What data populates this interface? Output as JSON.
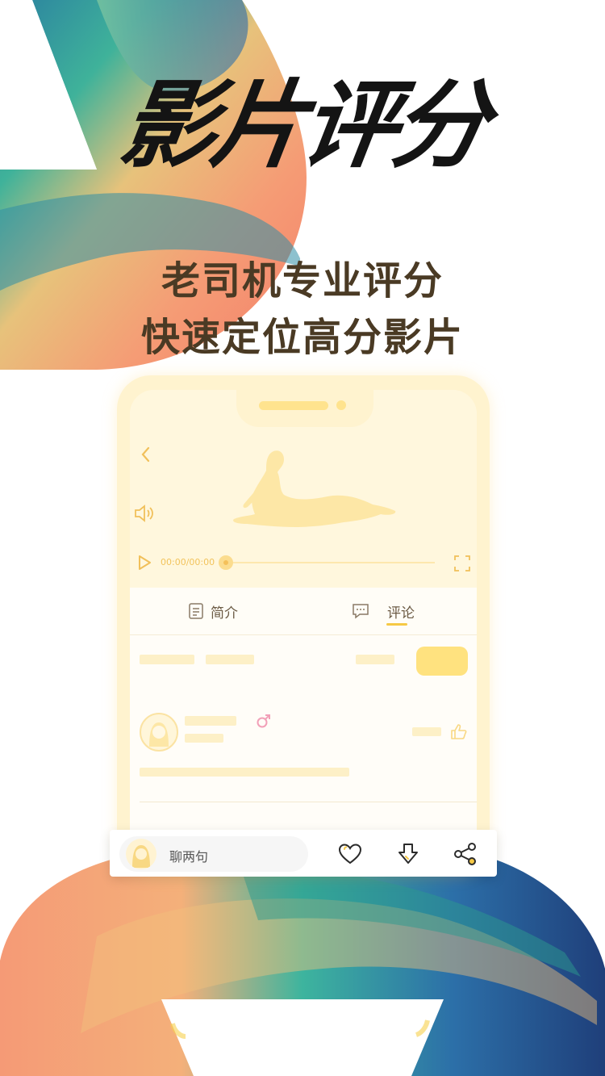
{
  "hero": {
    "title": "影片评分",
    "tagline_line1": "老司机专业评分",
    "tagline_line2": "快速定位高分影片"
  },
  "player": {
    "time": "00:00/00:00",
    "progress": 0
  },
  "tabs": [
    {
      "label": "简介",
      "icon": "document-icon",
      "active": false
    },
    {
      "label": "评论",
      "icon": "chat-bubble-icon",
      "active": true
    }
  ],
  "comment_bar": {
    "placeholder": "聊两句",
    "actions": [
      "heart-icon",
      "download-icon",
      "share-icon"
    ]
  },
  "colors": {
    "accent": "#f6c945",
    "placeholder": "#fdf0c7",
    "tagline": "#4a3a24"
  }
}
